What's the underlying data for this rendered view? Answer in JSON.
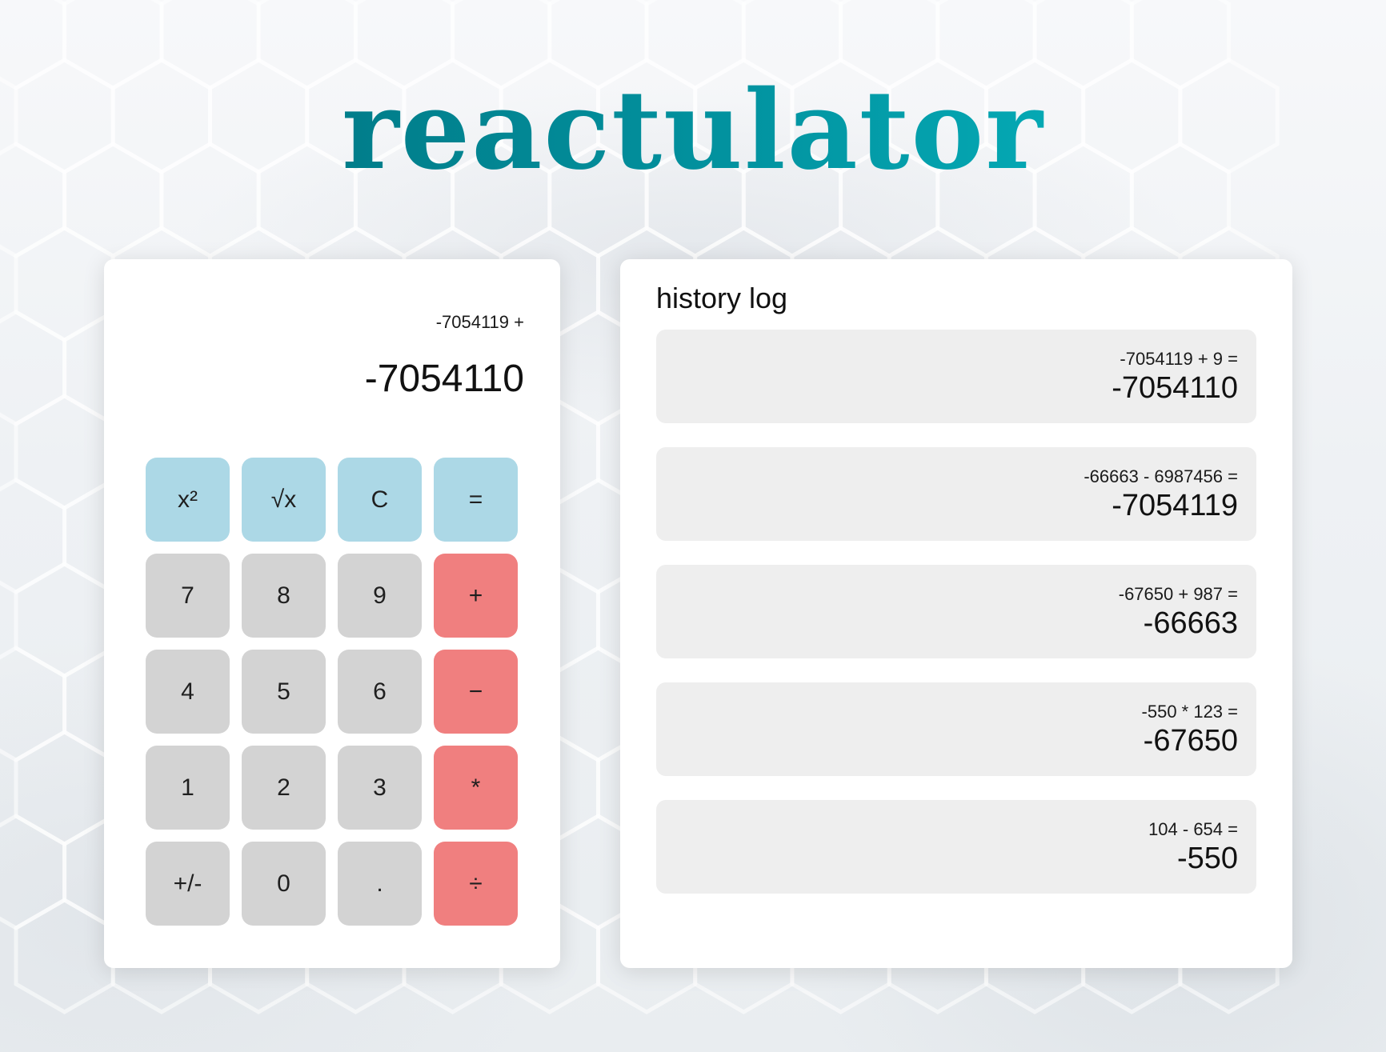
{
  "app": {
    "title": "reactulator"
  },
  "calculator": {
    "expression": "-7054119 +",
    "display": "-7054110",
    "keys": [
      {
        "label": "x²",
        "kind": "func",
        "name": "square-button"
      },
      {
        "label": "√x",
        "kind": "func",
        "name": "sqrt-button"
      },
      {
        "label": "C",
        "kind": "func",
        "name": "clear-button"
      },
      {
        "label": "=",
        "kind": "func",
        "name": "equals-button"
      },
      {
        "label": "7",
        "kind": "num",
        "name": "digit-7-button"
      },
      {
        "label": "8",
        "kind": "num",
        "name": "digit-8-button"
      },
      {
        "label": "9",
        "kind": "num",
        "name": "digit-9-button"
      },
      {
        "label": "+",
        "kind": "op",
        "name": "add-button"
      },
      {
        "label": "4",
        "kind": "num",
        "name": "digit-4-button"
      },
      {
        "label": "5",
        "kind": "num",
        "name": "digit-5-button"
      },
      {
        "label": "6",
        "kind": "num",
        "name": "digit-6-button"
      },
      {
        "label": "−",
        "kind": "op",
        "name": "subtract-button"
      },
      {
        "label": "1",
        "kind": "num",
        "name": "digit-1-button"
      },
      {
        "label": "2",
        "kind": "num",
        "name": "digit-2-button"
      },
      {
        "label": "3",
        "kind": "num",
        "name": "digit-3-button"
      },
      {
        "label": "*",
        "kind": "op",
        "name": "multiply-button"
      },
      {
        "label": "+/-",
        "kind": "num",
        "name": "negate-button"
      },
      {
        "label": "0",
        "kind": "num",
        "name": "digit-0-button"
      },
      {
        "label": ".",
        "kind": "num",
        "name": "decimal-button"
      },
      {
        "label": "÷",
        "kind": "op",
        "name": "divide-button"
      }
    ]
  },
  "history": {
    "title": "history log",
    "items": [
      {
        "expression": "-7054119 + 9 =",
        "result": "-7054110"
      },
      {
        "expression": "-66663 - 6987456 =",
        "result": "-7054119"
      },
      {
        "expression": "-67650 + 987 =",
        "result": "-66663"
      },
      {
        "expression": "-550 * 123 =",
        "result": "-67650"
      },
      {
        "expression": "104 - 654 =",
        "result": "-550"
      }
    ]
  },
  "colors": {
    "title_gradient_start": "#006b78",
    "title_gradient_end": "#07bfc9",
    "function_key": "#acd8e6",
    "number_key": "#d3d3d3",
    "operator_key": "#f07f7f",
    "history_item_bg": "#eeeeee"
  }
}
